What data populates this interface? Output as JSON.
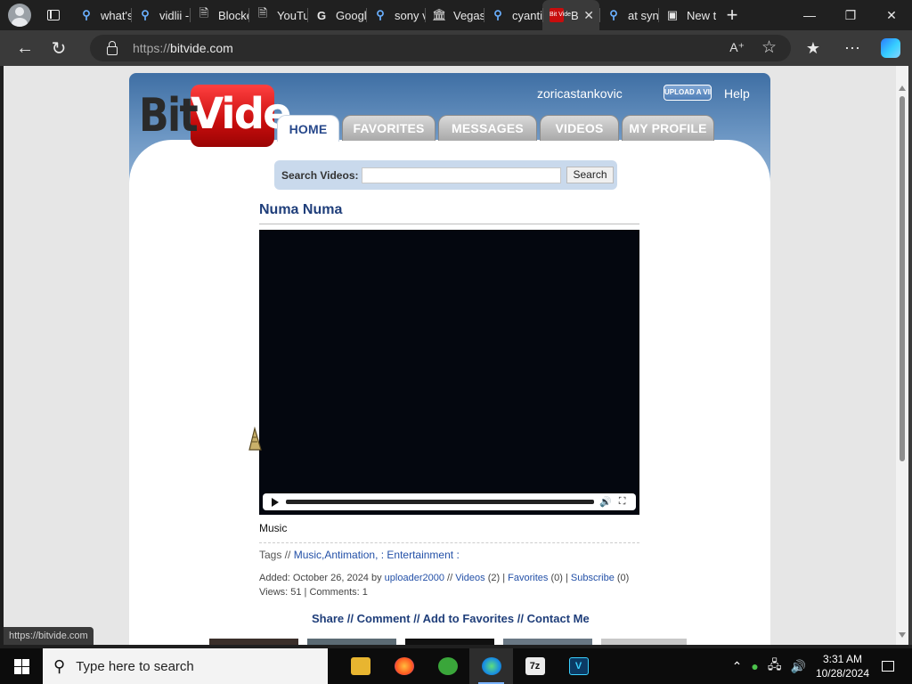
{
  "browser": {
    "tabs": [
      {
        "label": "what's",
        "icon": "search"
      },
      {
        "label": "vidlii -",
        "icon": "search"
      },
      {
        "label": "Blocked",
        "icon": "page"
      },
      {
        "label": "YouTube",
        "icon": "page"
      },
      {
        "label": "Google",
        "icon": "google"
      },
      {
        "label": "sony v",
        "icon": "search"
      },
      {
        "label": "Vegas",
        "icon": "bank"
      },
      {
        "label": "cyanti",
        "icon": "search"
      },
      {
        "label": "B",
        "icon": "bitvide",
        "active": true,
        "favicon_text": "Bit Vide"
      },
      {
        "label": "at syn",
        "icon": "search"
      },
      {
        "label": "New t",
        "icon": "newtab"
      }
    ],
    "url_scheme": "https://",
    "url_host": "bitvide.com",
    "status_url": "https://bitvide.com"
  },
  "site": {
    "logo_bit": "Bit",
    "logo_vide": "Vide",
    "username": "zoricastankovic",
    "upload_label": "UPLOAD A VIDEO",
    "help_label": "Help",
    "nav": [
      "HOME",
      "FAVORITES",
      "MESSAGES",
      "VIDEOS",
      "MY PROFILE"
    ],
    "search_label": "Search Videos:",
    "search_button": "Search",
    "video": {
      "title": "Numa Numa",
      "category": "Music",
      "tags_prefix": "Tags //",
      "tags": "Music,Antimation, : Entertainment :",
      "added_prefix": "Added: October 26, 2024 by",
      "uploader": "uploader2000",
      "videos_link": "Videos",
      "videos_count": "(2)",
      "favorites_link": "Favorites",
      "favorites_count": "(0)",
      "subscribe_link": "Subscribe",
      "subscribe_count": "(0)",
      "views_line": "Views: 51 | Comments: 1"
    },
    "actions": [
      "Share",
      "Comment",
      "Add to Favorites",
      "Contact Me"
    ]
  },
  "taskbar": {
    "search_placeholder": "Type here to search",
    "apps": [
      "File Explorer",
      "Firefox",
      "People",
      "Edge",
      "7-Zip",
      "Vegas"
    ],
    "time": "3:31 AM",
    "date": "10/28/2024"
  }
}
